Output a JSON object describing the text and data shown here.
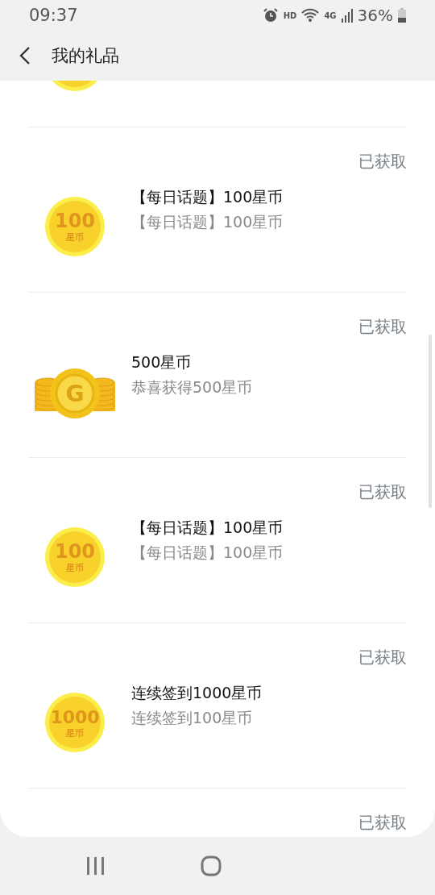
{
  "status_bar": {
    "time": "09:37",
    "hd": "HD",
    "network": "4G",
    "battery": "36%"
  },
  "app_bar": {
    "title": "我的礼品"
  },
  "gifts": [
    {
      "kind": "coin"
    },
    {
      "kind": "coin",
      "status": "已获取",
      "title": "【每日话题】100星币",
      "subtitle": "【每日话题】100星币",
      "coin_amount": "100",
      "coin_unit": "星币"
    },
    {
      "kind": "stack",
      "status": "已获取",
      "title": "500星币",
      "subtitle": "恭喜获得500星币",
      "icon_letter": "G"
    },
    {
      "kind": "coin",
      "status": "已获取",
      "title": "【每日话题】100星币",
      "subtitle": "【每日话题】100星币",
      "coin_amount": "100",
      "coin_unit": "星币"
    },
    {
      "kind": "coin",
      "status": "已获取",
      "title": "连续签到1000星币",
      "subtitle": "连续签到100星币",
      "coin_amount": "1000",
      "coin_unit": "星币"
    },
    {
      "kind": "none",
      "status": "已获取"
    }
  ]
}
